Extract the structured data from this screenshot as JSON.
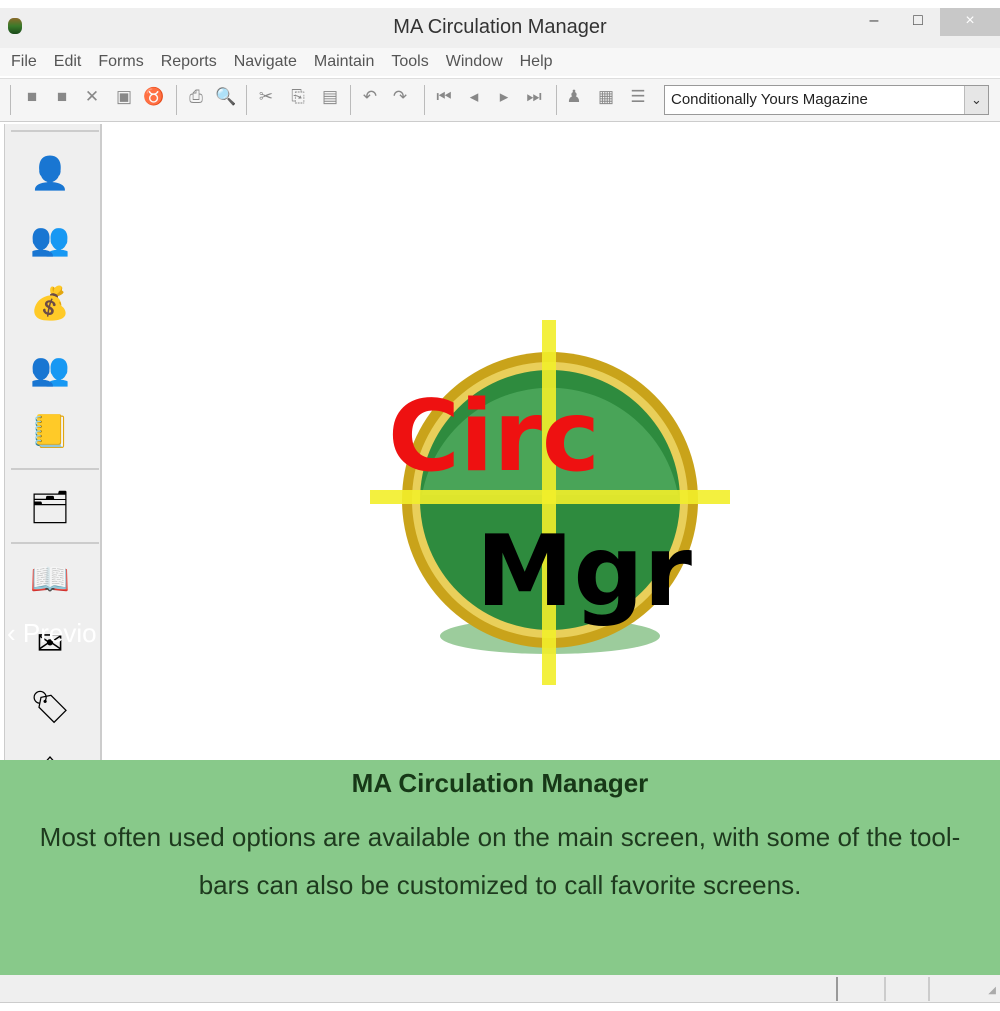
{
  "window": {
    "title": "MA Circulation Manager",
    "minimize": "–",
    "maximize": "□",
    "close": "×"
  },
  "menu": [
    "File",
    "Edit",
    "Forms",
    "Reports",
    "Navigate",
    "Maintain",
    "Tools",
    "Window",
    "Help"
  ],
  "toolbar": {
    "icons": [
      "new-icon",
      "open-icon",
      "delete-icon",
      "save-icon",
      "undo-changes-icon",
      "print-icon",
      "print-preview-icon",
      "cut-icon",
      "copy-icon",
      "paste-icon",
      "undo-icon",
      "redo-icon",
      "first-record-icon",
      "previous-record-icon",
      "next-record-icon",
      "last-record-icon",
      "find-icon",
      "filter-icon",
      "sort-icon"
    ],
    "publication_select": "Conditionally Yours Magazine"
  },
  "sidebar": {
    "icons": [
      "customer-icon",
      "customers-group-icon",
      "money-bag-icon",
      "contacts-icon",
      "notes-icon",
      "hierarchy-icon",
      "calendar-icon",
      "mail-edit-icon",
      "labels-icon",
      "home-icon"
    ],
    "overlay_text": "Previo",
    "overlay_arrow": "‹"
  },
  "logo": {
    "word1": "Circ",
    "word2": "Mgr",
    "ring_color": "#c9a31a",
    "fill_color": "#2e8b3e",
    "crosshair_color": "#f2ee2a",
    "word1_color": "#ee1111"
  },
  "caption": {
    "title": "MA Circulation Manager",
    "text": "Most often used options are available on the main screen, with some of the tool-bars can also be customized to call favorite screens.",
    "background": "#88c98a"
  }
}
